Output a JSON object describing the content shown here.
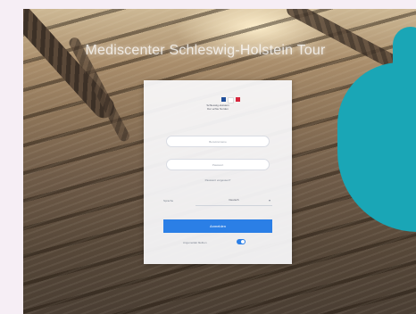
{
  "page": {
    "brand_title": "Mediscenter Schleswig-Holstein Tour"
  },
  "colors": {
    "accent": "#2b7fe6",
    "teal_shape": "#1aa6b6"
  },
  "logo": {
    "line1": "Schleswig-Holstein",
    "line2": "Der echte Norden",
    "flag_colors": [
      "#1f4e9a",
      "#ffffff",
      "#d7263d"
    ]
  },
  "form": {
    "username_placeholder": "Benutzername",
    "password_placeholder": "Passwort",
    "forgot_password": "Passwort vergessen?",
    "language_label": "Sprache",
    "language_value": "Deutsch",
    "login_button": "Anmelden",
    "remember_label": "Angemeldet bleiben",
    "remember_on": true
  }
}
